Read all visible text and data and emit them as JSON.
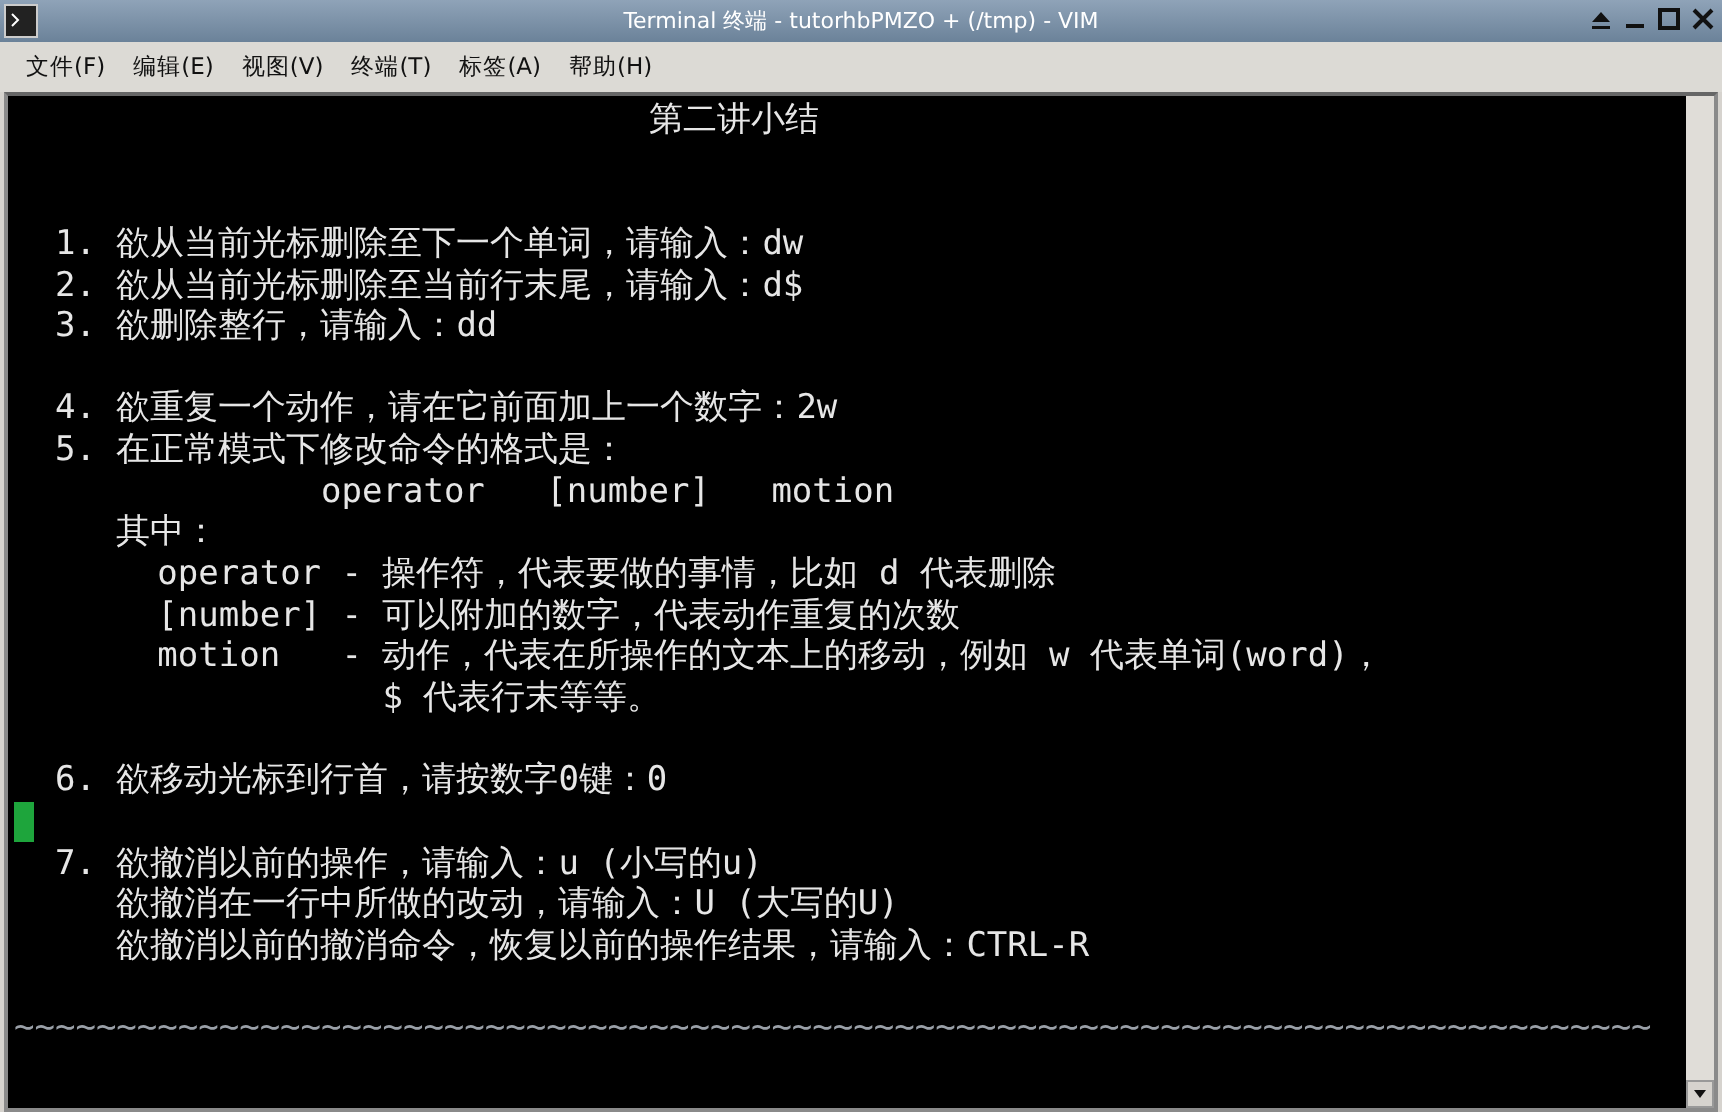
{
  "window": {
    "title": "Terminal 终端 - tutorhbPMZO + (/tmp) - VIM"
  },
  "menu": [
    {
      "label": "文件(F)"
    },
    {
      "label": "编辑(E)"
    },
    {
      "label": "视图(V)"
    },
    {
      "label": "终端(T)"
    },
    {
      "label": "标签(A)"
    },
    {
      "label": "帮助(H)"
    }
  ],
  "lines": [
    {
      "kind": "heading",
      "text": "第二讲小结"
    },
    {
      "kind": "blank"
    },
    {
      "kind": "blank"
    },
    {
      "kind": "text",
      "text": "  1. 欲从当前光标删除至下一个单词，请输入：dw"
    },
    {
      "kind": "text",
      "text": "  2. 欲从当前光标删除至当前行末尾，请输入：d$"
    },
    {
      "kind": "text",
      "text": "  3. 欲删除整行，请输入：dd"
    },
    {
      "kind": "blank"
    },
    {
      "kind": "text",
      "text": "  4. 欲重复一个动作，请在它前面加上一个数字：2w"
    },
    {
      "kind": "text",
      "text": "  5. 在正常模式下修改命令的格式是："
    },
    {
      "kind": "text",
      "text": "               operator   [number]   motion"
    },
    {
      "kind": "text",
      "text": "     其中："
    },
    {
      "kind": "text",
      "text": "       operator - 操作符，代表要做的事情，比如 d 代表删除"
    },
    {
      "kind": "text",
      "text": "       [number] - 可以附加的数字，代表动作重复的次数"
    },
    {
      "kind": "text",
      "text": "       motion   - 动作，代表在所操作的文本上的移动，例如 w 代表单词(word)，"
    },
    {
      "kind": "text",
      "text": "                  $ 代表行末等等。"
    },
    {
      "kind": "blank"
    },
    {
      "kind": "text",
      "text": "  6. 欲移动光标到行首，请按数字0键：0"
    },
    {
      "kind": "cursor"
    },
    {
      "kind": "text",
      "text": "  7. 欲撤消以前的操作，请输入：u (小写的u)"
    },
    {
      "kind": "text",
      "text": "     欲撤消在一行中所做的改动，请输入：U (大写的U)"
    },
    {
      "kind": "text",
      "text": "     欲撤消以前的撤消命令，恢复以前的操作结果，请输入：CTRL-R"
    },
    {
      "kind": "blank"
    },
    {
      "kind": "tilde",
      "text": "~~~~~~~~~~~~~~~~~~~~~~~~~~~~~~~~~~~~~~~~~~~~~~~~~~~~~~~~~~~~~~~~~~~~~~~~~~~~~~~~"
    }
  ]
}
